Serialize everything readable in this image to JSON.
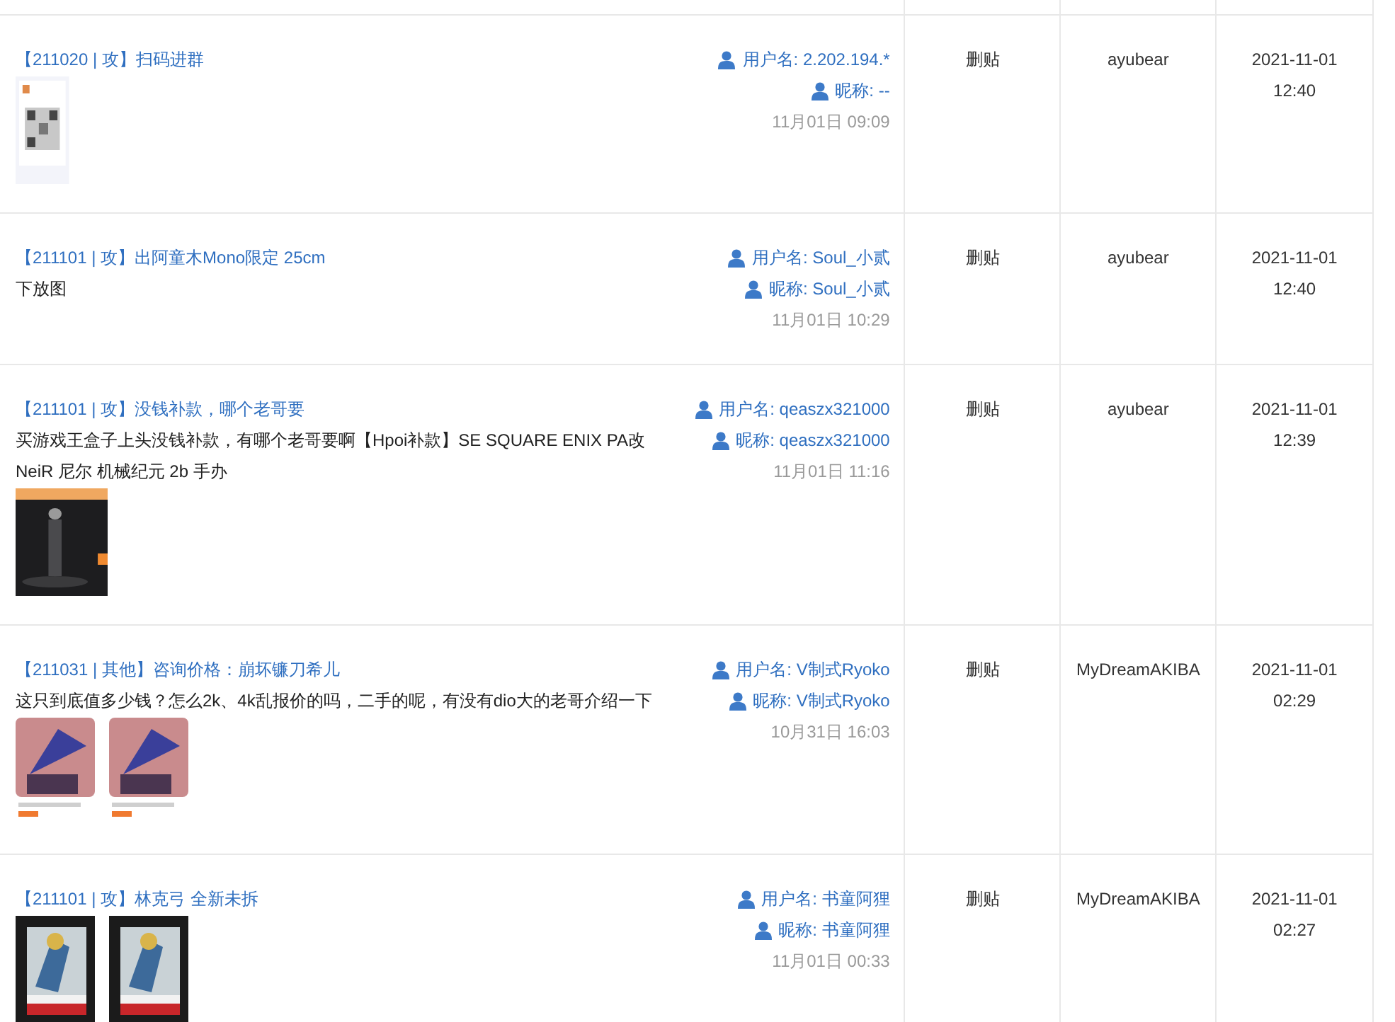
{
  "rows": [
    {
      "title": "【211020 | 攻】扫码进群",
      "username": "用户名: 2.202.194.*",
      "nickname": "昵称: --",
      "time": "11月01日 09:09",
      "action": "删贴",
      "operator": "ayubear",
      "date": "2021-11-01",
      "clock": "12:40"
    },
    {
      "title": "【211101 | 攻】出阿童木Mono限定 25cm",
      "body": "下放图",
      "username": "用户名: Soul_小贰",
      "nickname": "昵称: Soul_小贰",
      "time": "11月01日 10:29",
      "action": "删贴",
      "operator": "ayubear",
      "date": "2021-11-01",
      "clock": "12:40"
    },
    {
      "title": "【211101 | 攻】没钱补款，哪个老哥要",
      "body": "买游戏王盒子上头没钱补款，有哪个老哥要啊【Hpoi补款】SE SQUARE ENIX PA改 NeiR 尼尔 机械纪元 2b 手办",
      "username": "用户名: qeaszx321000",
      "nickname": "昵称: qeaszx321000",
      "time": "11月01日 11:16",
      "action": "删贴",
      "operator": "ayubear",
      "date": "2021-11-01",
      "clock": "12:39"
    },
    {
      "title": "【211031 | 其他】咨询价格：崩坏镰刀希儿",
      "body": "这只到底值多少钱？怎么2k、4k乱报价的吗，二手的呢，有没有dio大的老哥介绍一下",
      "username": "用户名: V制式Ryoko",
      "nickname": "昵称: V制式Ryoko",
      "time": "10月31日 16:03",
      "action": "删贴",
      "operator": "MyDreamAKIBA",
      "date": "2021-11-01",
      "clock": "02:29"
    },
    {
      "title": "【211101 | 攻】林克弓 全新未拆",
      "username": "用户名: 书童阿狸",
      "nickname": "昵称: 书童阿狸",
      "time": "11月01日 00:33",
      "action": "删贴",
      "operator": "MyDreamAKIBA",
      "date": "2021-11-01",
      "clock": "02:27"
    }
  ]
}
